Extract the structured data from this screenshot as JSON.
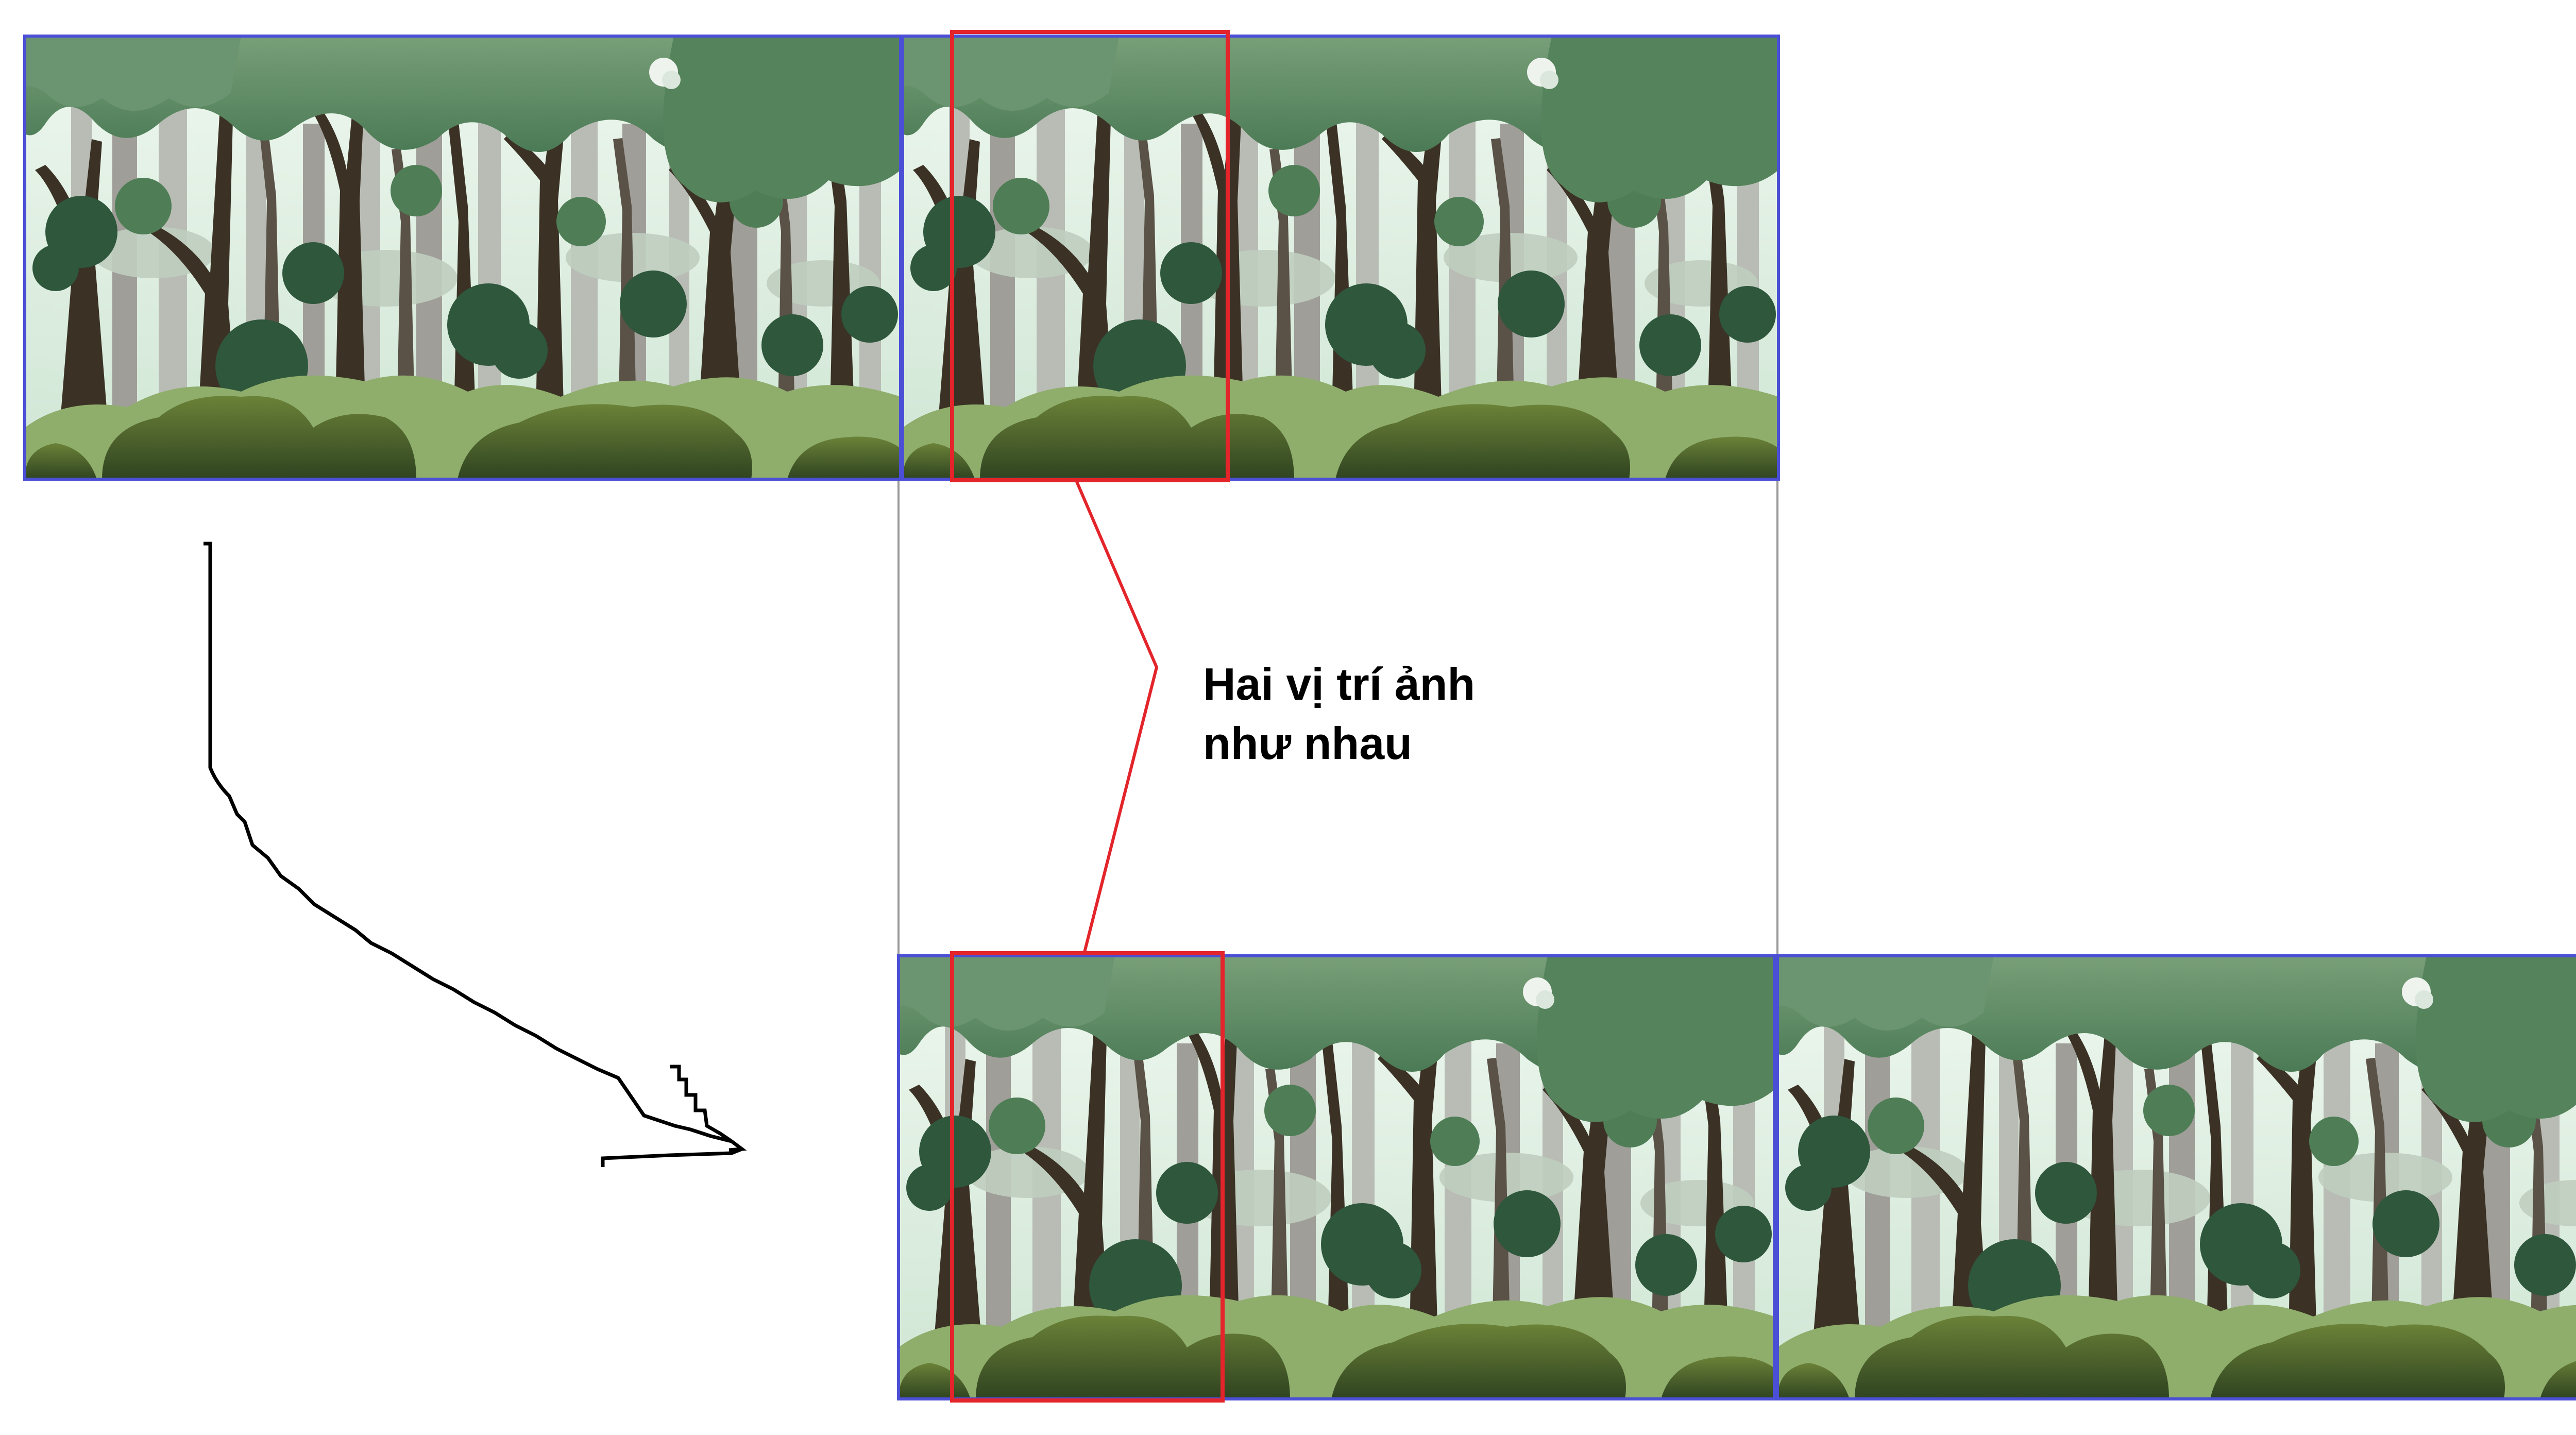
{
  "annotation": {
    "caption_line1": "Hai vị trí ảnh",
    "caption_line2": "như nhau"
  },
  "colors": {
    "tile_border": "#4b4fd6",
    "highlight": "#e3242b",
    "connector": "#e3242b",
    "guide_line": "#9a9a9a",
    "arrow": "#000000",
    "sky": "#dcefe2",
    "canopy_light": "#6e9a72",
    "canopy_mid": "#4f7e56",
    "canopy_dark": "#2e573c",
    "trunk_dark": "#3b3225",
    "trunk_mid": "#5a5147",
    "trunk_far": "#a7a6a2",
    "bush": "#556a2c",
    "ground": "#7ea05f"
  },
  "tiles": [
    {
      "name": "forest-tile-top-left"
    },
    {
      "name": "forest-tile-top-right"
    },
    {
      "name": "forest-tile-bottom-left"
    },
    {
      "name": "forest-tile-bottom-right"
    }
  ],
  "highlights": [
    {
      "name": "highlight-box-top"
    },
    {
      "name": "highlight-box-bottom"
    }
  ]
}
